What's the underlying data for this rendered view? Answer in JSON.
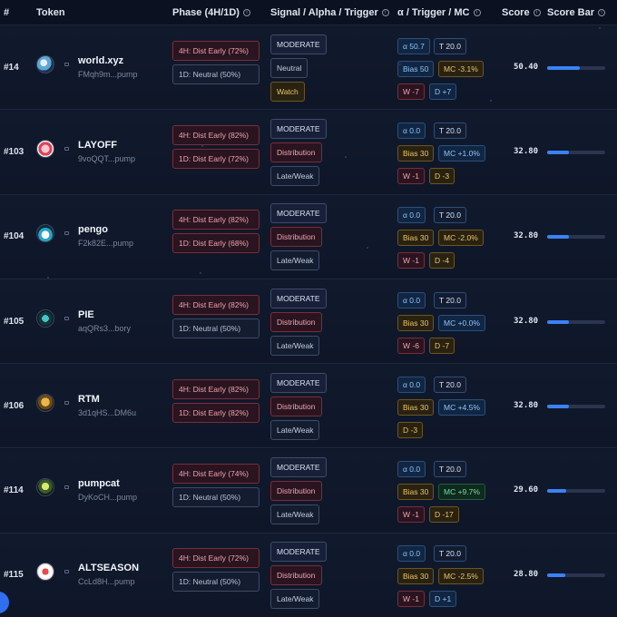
{
  "header": {
    "rank": "#",
    "token": "Token",
    "phase": "Phase (4H/1D)",
    "signal": "Signal / Alpha / Trigger",
    "alpha": "α / Trigger / MC",
    "score": "Score",
    "score_bar": "Score Bar"
  },
  "colors": {
    "accent": "#3b82f6",
    "dist": "#f0a3ac",
    "watch": "#e9c56a",
    "positive": "#6fe0a0",
    "info": "#8fc3ff"
  },
  "rows": [
    {
      "rank": "#14",
      "name": "world.xyz",
      "address": "FMqh9m...pump",
      "avatar_icon": "world-coin-icon",
      "phase_4h": "4H: Dist Early (72%)",
      "phase_1d": "1D: Neutral (50%)",
      "phase_1d_type": "neutral",
      "signal": "MODERATE",
      "alpha": "Neutral",
      "trigger": "Watch",
      "alpha_type": "neutral",
      "trigger_type": "watch",
      "a": "α 50.7",
      "t": "T 20.0",
      "bias": "Bias 50",
      "mc": "MC -3.1%",
      "w": "W -7",
      "d": "D +7",
      "bias_type": "blue",
      "mc_type": "amber",
      "w_type": "red",
      "d_type": "blue",
      "score": "50.40",
      "score_fill": 0.56
    },
    {
      "rank": "#103",
      "name": "LAYOFF",
      "address": "9voQQT...pump",
      "avatar_icon": "layoff-icon",
      "phase_4h": "4H: Dist Early (82%)",
      "phase_1d": "1D: Dist Early (72%)",
      "phase_1d_type": "dist",
      "signal": "MODERATE",
      "alpha": "Distribution",
      "trigger": "Late/Weak",
      "alpha_type": "dist",
      "trigger_type": "late",
      "a": "α 0.0",
      "t": "T 20.0",
      "bias": "Bias 30",
      "mc": "MC +1.0%",
      "w": "W -1",
      "d": "D -3",
      "bias_type": "amber",
      "mc_type": "blue",
      "w_type": "red",
      "d_type": "amber",
      "score": "32.80",
      "score_fill": 0.37
    },
    {
      "rank": "#104",
      "name": "pengo",
      "address": "F2k82E...pump",
      "avatar_icon": "penguin-icon",
      "phase_4h": "4H: Dist Early (82%)",
      "phase_1d": "1D: Dist Early (68%)",
      "phase_1d_type": "dist",
      "signal": "MODERATE",
      "alpha": "Distribution",
      "trigger": "Late/Weak",
      "alpha_type": "dist",
      "trigger_type": "late",
      "a": "α 0.0",
      "t": "T 20.0",
      "bias": "Bias 30",
      "mc": "MC -2.0%",
      "w": "W -1",
      "d": "D -4",
      "bias_type": "amber",
      "mc_type": "amber",
      "w_type": "red",
      "d_type": "amber",
      "score": "32.80",
      "score_fill": 0.37
    },
    {
      "rank": "#105",
      "name": "PIE",
      "address": "aqQRs3...bory",
      "avatar_icon": "pie-icon",
      "phase_4h": "4H: Dist Early (82%)",
      "phase_1d": "1D: Neutral (50%)",
      "phase_1d_type": "neutral",
      "signal": "MODERATE",
      "alpha": "Distribution",
      "trigger": "Late/Weak",
      "alpha_type": "dist",
      "trigger_type": "late",
      "a": "α 0.0",
      "t": "T 20.0",
      "bias": "Bias 30",
      "mc": "MC +0.0%",
      "w": "W -6",
      "d": "D -7",
      "bias_type": "amber",
      "mc_type": "blue",
      "w_type": "red",
      "d_type": "amber",
      "score": "32.80",
      "score_fill": 0.37
    },
    {
      "rank": "#106",
      "name": "RTM",
      "address": "3d1qHS...DM6u",
      "avatar_icon": "rtm-icon",
      "phase_4h": "4H: Dist Early (82%)",
      "phase_1d": "1D: Dist Early (82%)",
      "phase_1d_type": "dist",
      "signal": "MODERATE",
      "alpha": "Distribution",
      "trigger": "Late/Weak",
      "alpha_type": "dist",
      "trigger_type": "late",
      "a": "α 0.0",
      "t": "T 20.0",
      "bias": "Bias 30",
      "mc": "MC +4.5%",
      "w": "",
      "d": "D -3",
      "bias_type": "amber",
      "mc_type": "blue",
      "w_type": "red",
      "d_type": "amber",
      "score": "32.80",
      "score_fill": 0.37
    },
    {
      "rank": "#114",
      "name": "pumpcat",
      "address": "DyKoCH...pump",
      "avatar_icon": "cat-icon",
      "phase_4h": "4H: Dist Early (74%)",
      "phase_1d": "1D: Neutral (50%)",
      "phase_1d_type": "neutral",
      "signal": "MODERATE",
      "alpha": "Distribution",
      "trigger": "Late/Weak",
      "alpha_type": "dist",
      "trigger_type": "late",
      "a": "α 0.0",
      "t": "T 20.0",
      "bias": "Bias 30",
      "mc": "MC +9.7%",
      "w": "W -1",
      "d": "D -17",
      "bias_type": "amber",
      "mc_type": "green",
      "w_type": "red",
      "d_type": "amber",
      "score": "29.60",
      "score_fill": 0.33
    },
    {
      "rank": "#115",
      "name": "ALTSEASON",
      "address": "CcLd8H...pump",
      "avatar_icon": "altseason-icon",
      "phase_4h": "4H: Dist Early (72%)",
      "phase_1d": "1D: Neutral (50%)",
      "phase_1d_type": "neutral",
      "signal": "MODERATE",
      "alpha": "Distribution",
      "trigger": "Late/Weak",
      "alpha_type": "dist",
      "trigger_type": "late",
      "a": "α 0.0",
      "t": "T 20.0",
      "bias": "Bias 30",
      "mc": "MC -2.5%",
      "w": "W -1",
      "d": "D +1",
      "bias_type": "amber",
      "mc_type": "amber",
      "w_type": "red",
      "d_type": "blue",
      "score": "28.80",
      "score_fill": 0.32
    }
  ]
}
